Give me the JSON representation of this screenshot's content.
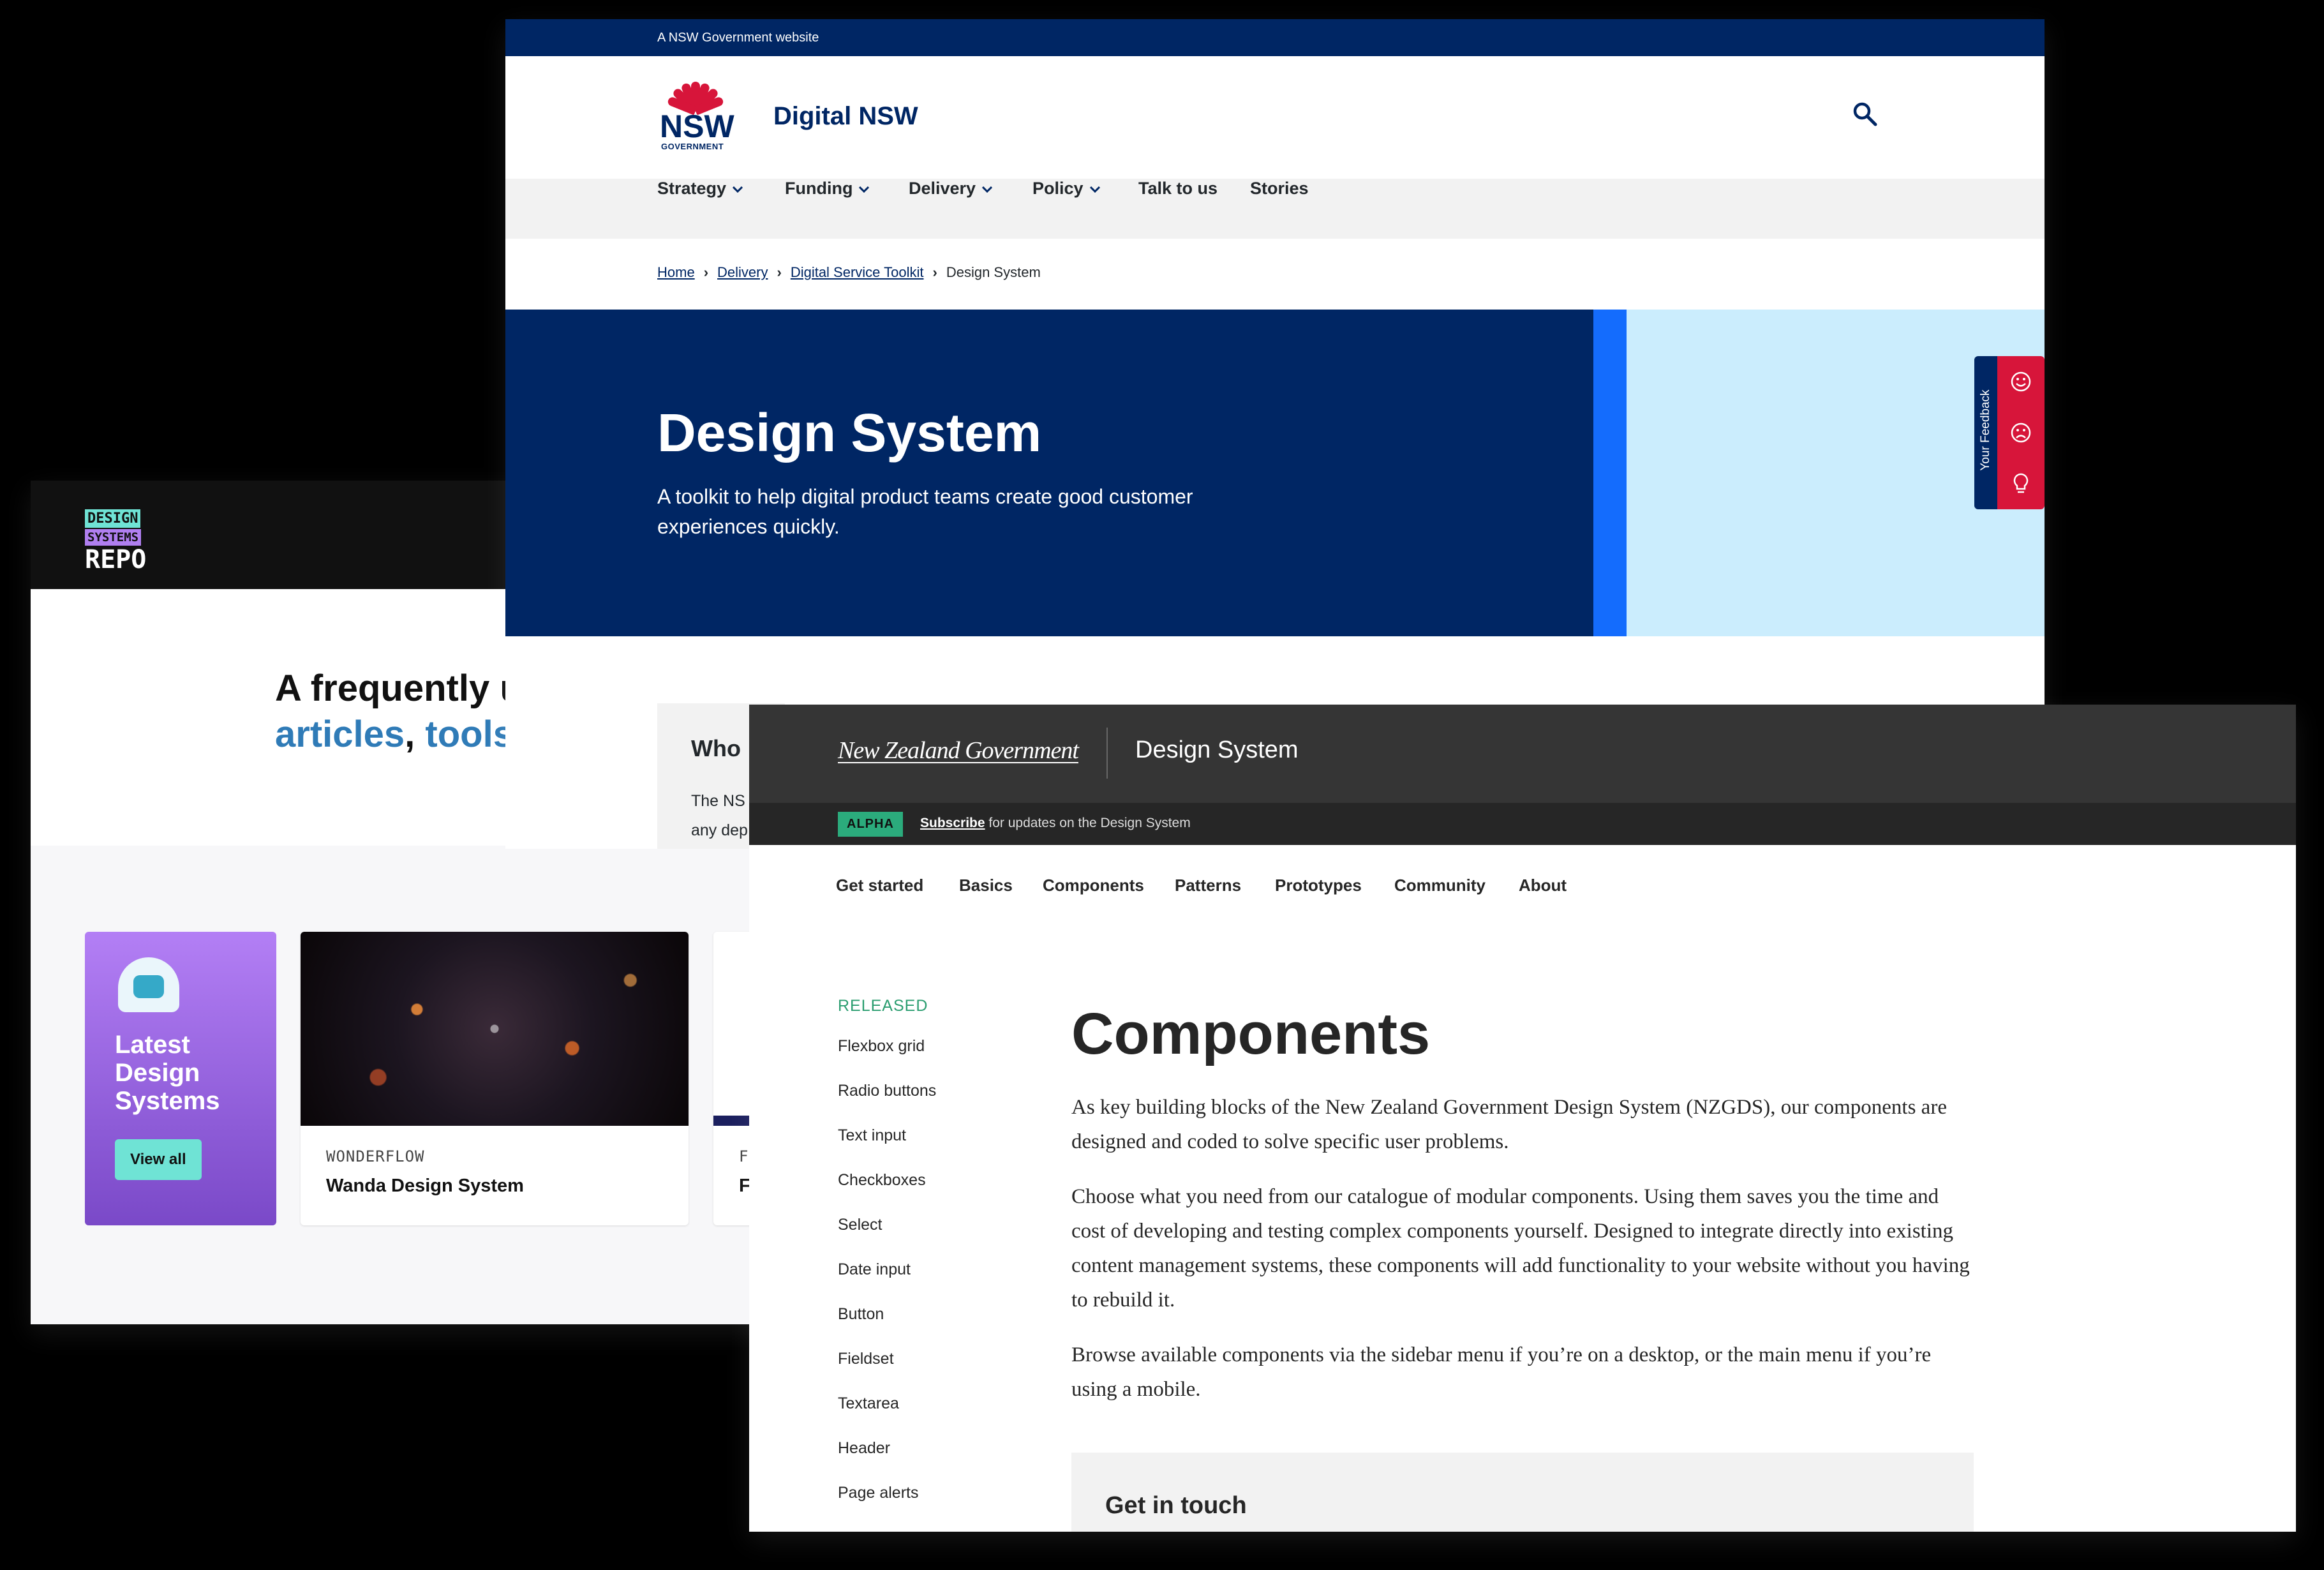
{
  "repo": {
    "logo_line1": "DESIGN",
    "logo_line2": "SYSTEMS",
    "logo_line3": "REPO",
    "hero_title_start": "A frequently u",
    "hero_links": [
      "articles",
      "tools"
    ],
    "hero_sep": ",",
    "feature_card": {
      "title": "Latest Design Systems",
      "button": "View all"
    },
    "cards": [
      {
        "eyebrow": "WONDERFLOW",
        "title": "Wanda Design System"
      },
      {
        "eyebrow": "F",
        "title": "F"
      }
    ]
  },
  "nsw": {
    "masthead": "A NSW Government website",
    "logo_text": "NSW",
    "logo_subtext": "GOVERNMENT",
    "site_name": "Digital NSW",
    "nav": [
      {
        "label": "Strategy",
        "dropdown": true
      },
      {
        "label": "Funding",
        "dropdown": true
      },
      {
        "label": "Delivery",
        "dropdown": true
      },
      {
        "label": "Policy",
        "dropdown": true
      },
      {
        "label": "Talk to us",
        "dropdown": false
      },
      {
        "label": "Stories",
        "dropdown": false
      }
    ],
    "breadcrumbs": [
      "Home",
      "Delivery",
      "Digital Service Toolkit",
      "Design System"
    ],
    "hero": {
      "title": "Design System",
      "intro": "A toolkit to help digital product teams create good customer experiences quickly."
    },
    "feedback": {
      "label": "Your Feedback",
      "icons": [
        "smile-icon",
        "frown-icon",
        "lightbulb-icon"
      ]
    },
    "info_box": {
      "heading": "Who",
      "line1": "The NS",
      "line2": "any dep"
    }
  },
  "nz": {
    "government": "New Zealand Government",
    "site_name": "Design System",
    "phase_tag": "ALPHA",
    "banner_link": "Subscribe",
    "banner_text": " for updates on the Design System",
    "nav": [
      "Get started",
      "Basics",
      "Components",
      "Patterns",
      "Prototypes",
      "Community",
      "About"
    ],
    "active_nav": "Components",
    "sidebar_heading": "RELEASED",
    "sidebar": [
      "Flexbox grid",
      "Radio buttons",
      "Text input",
      "Checkboxes",
      "Select",
      "Date input",
      "Button",
      "Fieldset",
      "Textarea",
      "Header",
      "Page alerts"
    ],
    "title": "Components",
    "paragraphs": [
      "As key building blocks of the New Zealand Government Design System (NZGDS), our components are designed and coded to solve specific user problems.",
      "Choose what you need from our catalogue of modular components. Using them saves you the time and cost of developing and testing complex components yourself. Designed to integrate directly into existing content management systems, these components will add functionality to your website without you having to rebuild it.",
      "Browse available components via the sidebar menu if you’re on a desktop, or the main menu if you’re using a mobile."
    ],
    "get_in_touch": "Get in touch"
  },
  "colors": {
    "nsw_navy": "#002664",
    "nsw_red": "#d7153a",
    "nsw_blue": "#146cfd",
    "nz_green": "#2bab7c",
    "repo_teal": "#6fe3d5",
    "repo_purple": "#b07ff0"
  }
}
